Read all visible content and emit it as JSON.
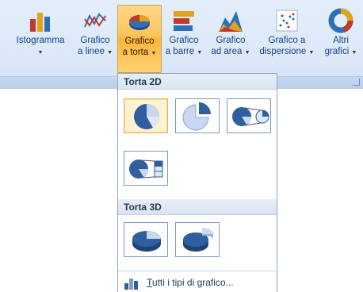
{
  "ribbon": {
    "buttons": [
      {
        "line1": "Istogramma",
        "line2": "",
        "icon": "column-chart-icon"
      },
      {
        "line1": "Grafico",
        "line2": "a linee",
        "icon": "line-chart-icon"
      },
      {
        "line1": "Grafico",
        "line2": "a torta",
        "icon": "pie-chart-icon",
        "active": true
      },
      {
        "line1": "Grafico",
        "line2": "a barre",
        "icon": "bar-chart-icon"
      },
      {
        "line1": "Grafico",
        "line2": "ad area",
        "icon": "area-chart-icon"
      },
      {
        "line1": "Grafico a",
        "line2": "dispersione",
        "icon": "scatter-chart-icon"
      },
      {
        "line1": "Altri",
        "line2": "grafici",
        "icon": "doughnut-chart-icon"
      }
    ]
  },
  "dropdown": {
    "section_2d": "Torta 2D",
    "section_3d": "Torta 3D",
    "tiles_2d": [
      {
        "name": "pie-2d-tile",
        "selected": true
      },
      {
        "name": "exploded-pie-2d-tile"
      },
      {
        "name": "pie-of-pie-tile"
      },
      {
        "name": "bar-of-pie-tile"
      }
    ],
    "tiles_3d": [
      {
        "name": "pie-3d-tile"
      },
      {
        "name": "exploded-pie-3d-tile"
      }
    ],
    "footer_underline": "T",
    "footer_rest": "utti i tipi di grafico..."
  },
  "colors": {
    "ribbon_bg": "#dbe8f8",
    "active_button": "#ffc35a",
    "pie_blue": "#2f5f9e",
    "pie_light": "#c9d8ee"
  }
}
